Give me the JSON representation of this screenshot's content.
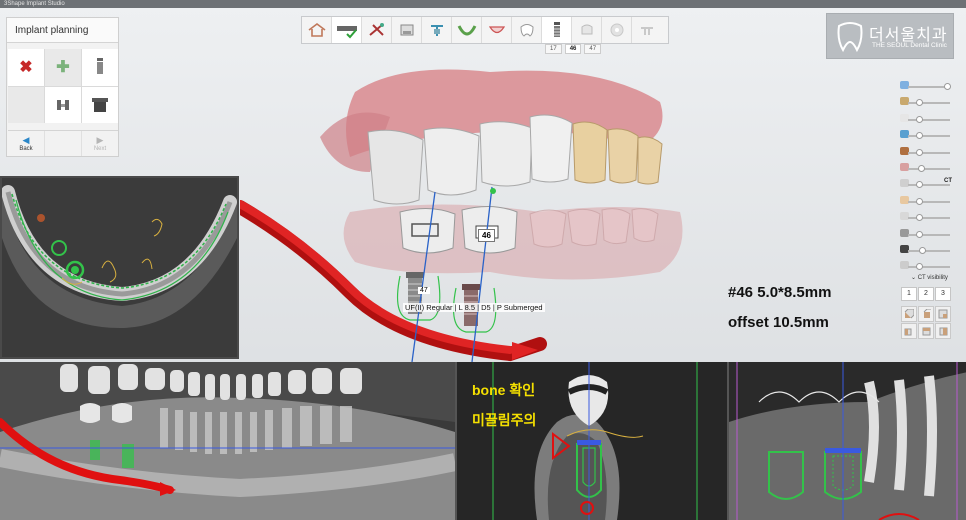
{
  "window": {
    "title": "3Shape Implant Studio"
  },
  "toolbar": {
    "icons": [
      "home-icon",
      "bar-check-icon",
      "tools-icon",
      "scan-icon",
      "implant-align-icon",
      "arch-icon",
      "crown-outline-icon",
      "tooth-icon",
      "implant-icon",
      "crown-ghost-icon",
      "settings-ghost-icon",
      "guide-icon"
    ],
    "tooth_tabs": [
      "17",
      "46",
      "47"
    ],
    "active_tab": "46"
  },
  "logo": {
    "name_ko": "더서울치과",
    "name_en": "THE SEOUL Dental Clinic"
  },
  "panel": {
    "title": "Implant planning",
    "back_label": "Back",
    "next_label": "Next"
  },
  "view3d": {
    "tooth_labels": {
      "crown": "46",
      "implant": "47"
    },
    "implant_spec": "UF(II) Regular | L 8.5 | D5 | P Submerged"
  },
  "annotation": {
    "line1": "#46 5.0*8.5mm",
    "line2": "offset 10.5mm"
  },
  "right_panel": {
    "ct_label": "CT",
    "ct_visibility_label": "CT visibility",
    "ct_buttons": [
      "1",
      "2",
      "3"
    ],
    "slider_levels": [
      0.95,
      0.2,
      0.2,
      0.2,
      0.2,
      0.25,
      0.2,
      0.2,
      0.2,
      0.2,
      0.3,
      0.2
    ]
  },
  "ct_panels": {
    "bone_note": "bone 확인",
    "nerve_note": "미끌림주의"
  },
  "colors": {
    "implant_green": "#33c24a",
    "nerve_red": "#e01010",
    "annotation_yellow": "#f5e000",
    "gum_pink": "#d98a8e"
  }
}
